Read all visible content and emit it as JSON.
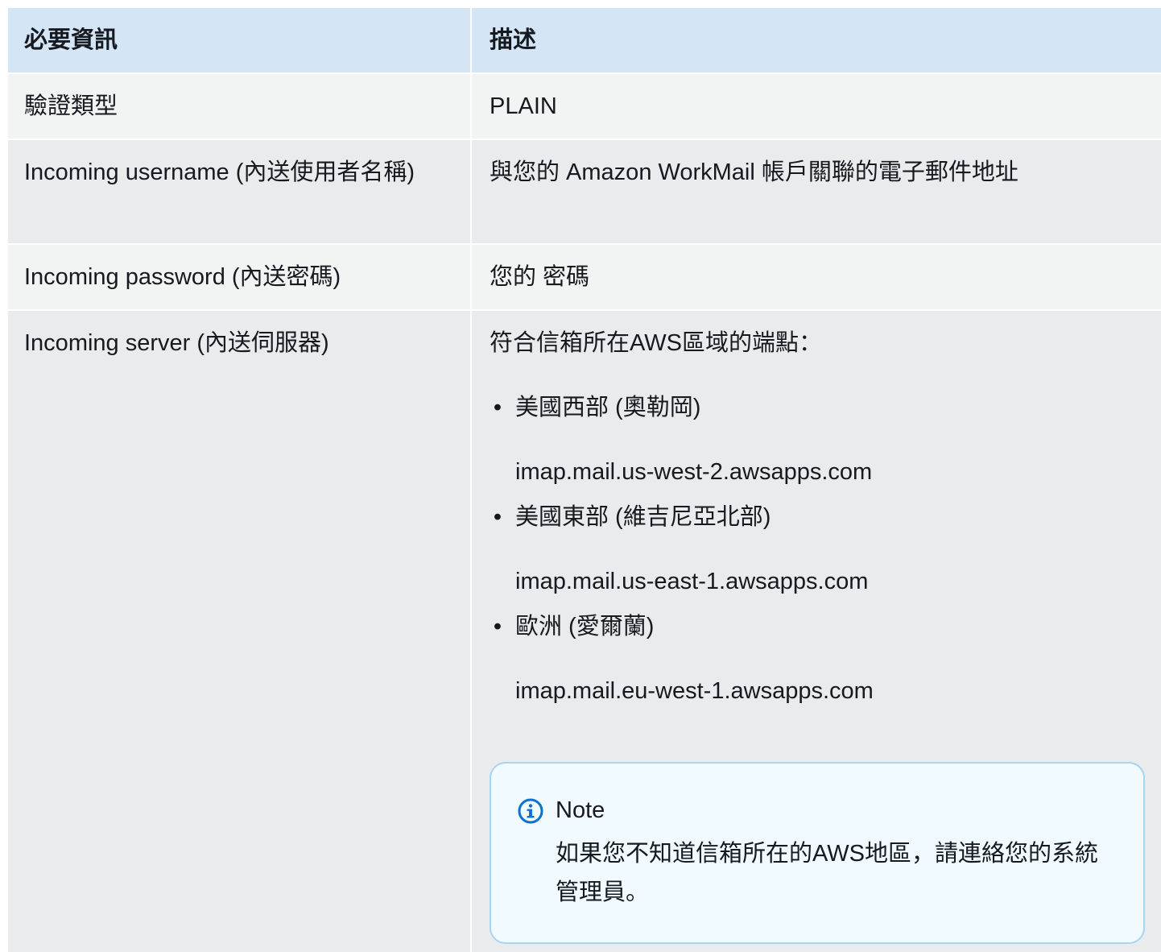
{
  "table": {
    "headers": [
      "必要資訊",
      "描述"
    ],
    "rows": {
      "auth_type": {
        "label": "驗證類型",
        "value": "PLAIN"
      },
      "username": {
        "label": "Incoming username (內送使用者名稱)",
        "value": "與您的 Amazon WorkMail 帳戶關聯的電子郵件地址"
      },
      "password": {
        "label": "Incoming password (內送密碼)",
        "value": "您的 密碼"
      },
      "server": {
        "label": "Incoming server (內送伺服器)",
        "intro": "符合信箱所在AWS區域的端點：",
        "regions": [
          {
            "name": "美國西部 (奧勒岡)",
            "endpoint": "imap.mail.us-west-2.awsapps.com"
          },
          {
            "name": "美國東部 (維吉尼亞北部)",
            "endpoint": "imap.mail.us-east-1.awsapps.com"
          },
          {
            "name": "歐洲 (愛爾蘭)",
            "endpoint": "imap.mail.eu-west-1.awsapps.com"
          }
        ],
        "note": {
          "icon": "info-icon",
          "title": "Note",
          "text": "如果您不知道信箱所在的AWS地區，請連絡您的系統管理員。"
        }
      }
    }
  },
  "colors": {
    "header_bg": "#d4e6f6",
    "row_bg_light": "#f2f3f3",
    "row_bg_dark": "#e9ebed",
    "note_bg": "#f1faff",
    "note_border": "#a8d5ef",
    "info_icon": "#0972d3"
  }
}
